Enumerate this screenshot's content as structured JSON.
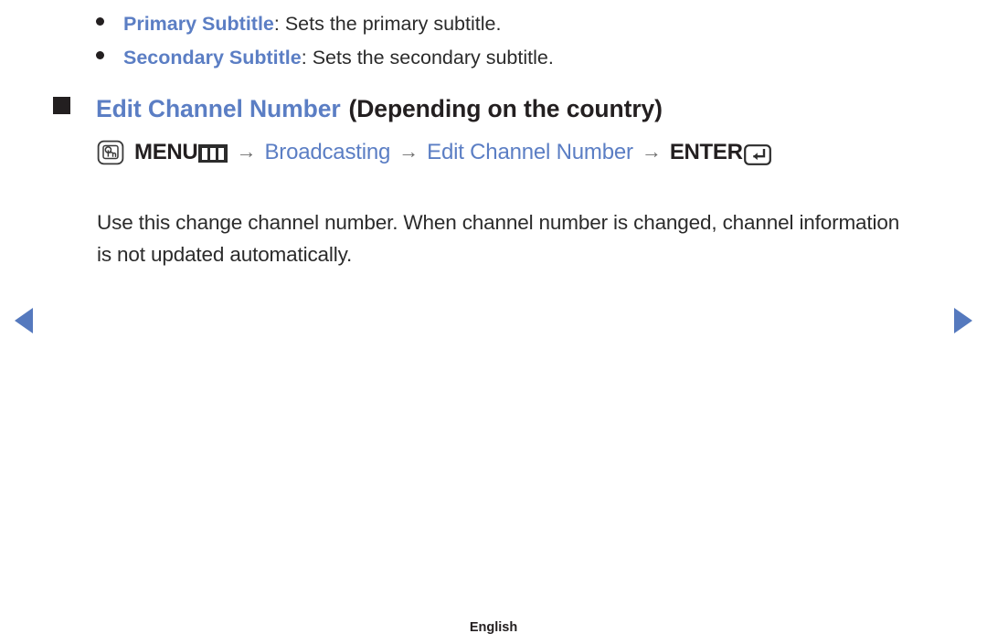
{
  "page": {
    "background": "#ffffff",
    "accent_blue": "#5b7ec4",
    "text_color": "#231f20",
    "arrow_color": "#5579be"
  },
  "bullet_list": {
    "items": [
      {
        "bullet_icon": "dot-bullet-icon",
        "term": "Primary Subtitle",
        "description": ": Sets the primary subtitle."
      },
      {
        "bullet_icon": "dot-bullet-icon",
        "term": "Secondary Subtitle",
        "description": ": Sets the secondary subtitle."
      }
    ]
  },
  "section": {
    "bullet_icon": "square-bullet-icon",
    "heading_main": "Edit Channel Number",
    "heading_sub": "(Depending on the country)"
  },
  "menu_path": {
    "touch_icon": "hand-press-icon",
    "menu_label": "MENU",
    "menu_glyph_icon": "menu-bars-icon",
    "separator": "→",
    "step_broadcasting": "Broadcasting",
    "step_edit_channel_number": "Edit Channel Number",
    "enter_label": "ENTER",
    "enter_glyph_icon": "enter-return-icon"
  },
  "body": {
    "paragraph": "Use this change channel number. When channel number is changed, channel information is not updated automatically."
  },
  "navigation": {
    "prev_icon": "triangle-left-icon",
    "next_icon": "triangle-right-icon"
  },
  "footer": {
    "language": "English"
  }
}
